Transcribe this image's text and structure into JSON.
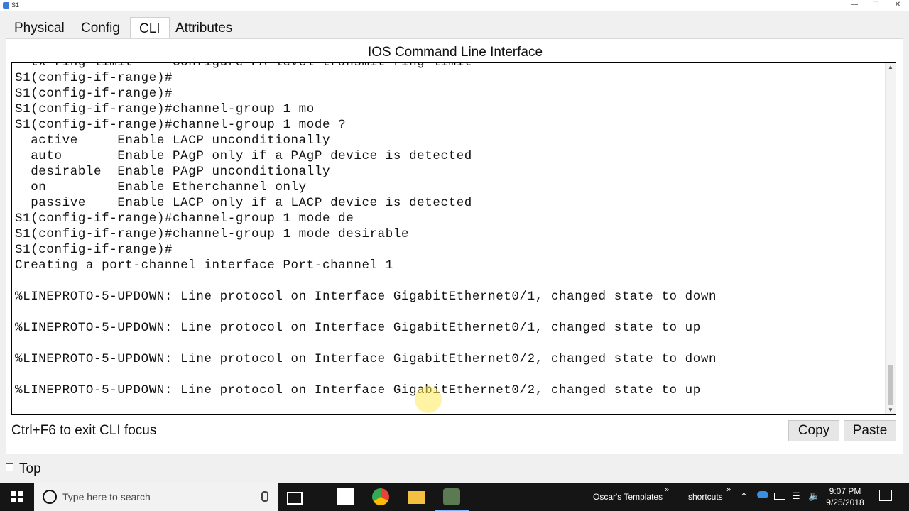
{
  "window": {
    "title": "S1",
    "controls": [
      "minimize",
      "restore",
      "close"
    ]
  },
  "tabs": [
    {
      "label": "Physical",
      "active": false
    },
    {
      "label": "Config",
      "active": false
    },
    {
      "label": "CLI",
      "active": true
    },
    {
      "label": "Attributes",
      "active": false
    }
  ],
  "panel": {
    "title": "IOS Command Line Interface"
  },
  "console": {
    "lines": [
      "  tx-ring-limit     Configure PA level transmit ring limit",
      "S1(config-if-range)#",
      "S1(config-if-range)#",
      "S1(config-if-range)#channel-group 1 mo",
      "S1(config-if-range)#channel-group 1 mode ?",
      "  active     Enable LACP unconditionally",
      "  auto       Enable PAgP only if a PAgP device is detected",
      "  desirable  Enable PAgP unconditionally",
      "  on         Enable Etherchannel only",
      "  passive    Enable LACP only if a LACP device is detected",
      "S1(config-if-range)#channel-group 1 mode de",
      "S1(config-if-range)#channel-group 1 mode desirable",
      "S1(config-if-range)#",
      "Creating a port-channel interface Port-channel 1",
      "",
      "%LINEPROTO-5-UPDOWN: Line protocol on Interface GigabitEthernet0/1, changed state to down",
      "",
      "%LINEPROTO-5-UPDOWN: Line protocol on Interface GigabitEthernet0/1, changed state to up",
      "",
      "%LINEPROTO-5-UPDOWN: Line protocol on Interface GigabitEthernet0/2, changed state to down",
      "",
      "%LINEPROTO-5-UPDOWN: Line protocol on Interface GigabitEthernet0/2, changed state to up"
    ]
  },
  "status": {
    "text": "Ctrl+F6 to exit CLI focus"
  },
  "buttons": {
    "copy": "Copy",
    "paste": "Paste"
  },
  "top_checkbox": {
    "label": "Top",
    "checked": false
  },
  "taskbar": {
    "search_placeholder": "Type here to search",
    "toolbar_labels": [
      "Oscar's Templates",
      "shortcuts"
    ],
    "time": "9:07 PM",
    "date": "9/25/2018",
    "accent_color": "#7fb2ff"
  }
}
